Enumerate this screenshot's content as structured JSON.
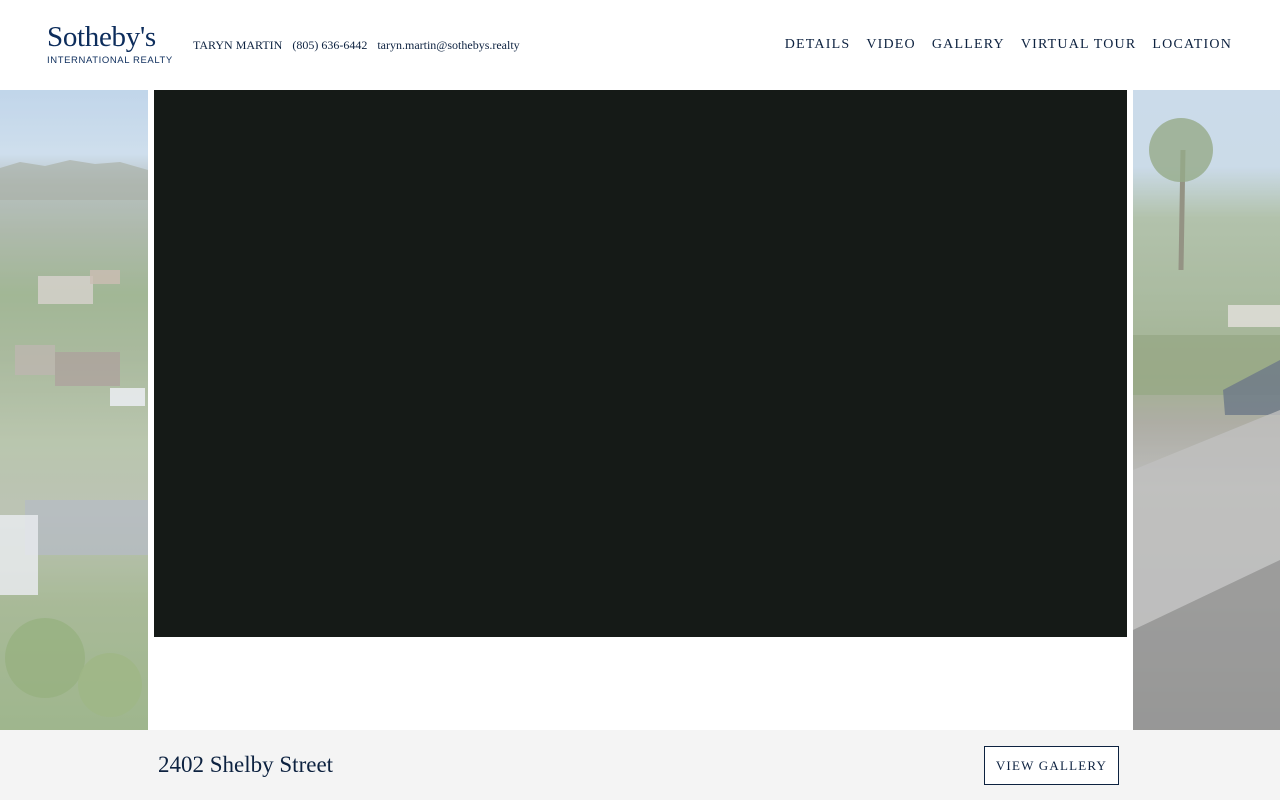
{
  "brand": {
    "name": "Sotheby's",
    "subtitle": "INTERNATIONAL REALTY",
    "color": "#0d2d5c"
  },
  "agent": {
    "name": "TARYN MARTIN",
    "phone": "(805) 636-6442",
    "email": "taryn.martin@sothebys.realty"
  },
  "nav": {
    "items": [
      "DETAILS",
      "VIDEO",
      "GALLERY",
      "VIRTUAL TOUR",
      "LOCATION"
    ]
  },
  "property": {
    "address": "2402 Shelby Street"
  },
  "actions": {
    "view_gallery": "VIEW GALLERY"
  }
}
